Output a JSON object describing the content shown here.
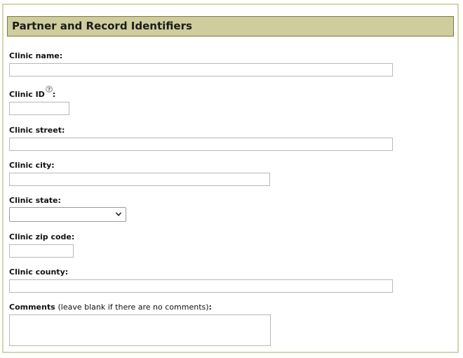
{
  "section": {
    "title": "Partner and Record Identifiers"
  },
  "fields": {
    "clinic_name": {
      "label": "Clinic name:",
      "value": ""
    },
    "clinic_id": {
      "label": "Clinic ID",
      "suffix": ":",
      "value": "",
      "help_icon": "question-mark-circle-icon"
    },
    "clinic_street": {
      "label": "Clinic street:",
      "value": ""
    },
    "clinic_city": {
      "label": "Clinic city:",
      "value": ""
    },
    "clinic_state": {
      "label": "Clinic state:",
      "selected": ""
    },
    "clinic_zip": {
      "label": "Clinic zip code:",
      "value": ""
    },
    "clinic_county": {
      "label": "Clinic county:",
      "value": ""
    },
    "comments": {
      "label": "Comments",
      "note": "(leave blank if there are no comments)",
      "suffix": ":",
      "value": ""
    }
  },
  "colors": {
    "header_background": "#cfcd9d",
    "header_border": "#7d7a45",
    "panel_border": "#d5d5ad"
  }
}
